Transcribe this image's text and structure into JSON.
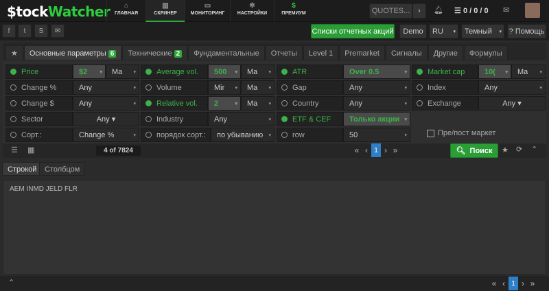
{
  "header": {
    "logo_prefix": "$tock",
    "logo_suffix": "Watcher",
    "nav": [
      {
        "icon": "home-icon",
        "glyph": "⌂",
        "label": "ГЛАВНАЯ"
      },
      {
        "icon": "bar-chart-icon",
        "glyph": "▥",
        "label": "СКРИНЕР"
      },
      {
        "icon": "monitor-icon",
        "glyph": "▭",
        "label": "МОНИТОРИНГ"
      },
      {
        "icon": "gear-icon",
        "glyph": "✲",
        "label": "НАСТРОЙКИ"
      },
      {
        "icon": "dollar-icon",
        "glyph": "$",
        "label": "ПРЕМИУМ"
      }
    ],
    "quotes_placeholder": "QUOTES...",
    "counters": "0 / 0 / 0"
  },
  "toolbar": {
    "reports_button": "Списки отчетных акций",
    "demo": "Demo",
    "lang": "RU",
    "theme": "Темный",
    "help": "? Помощь"
  },
  "tabs": [
    {
      "label": "Основные параметры",
      "badge": "6"
    },
    {
      "label": "Технические",
      "badge": "2"
    },
    {
      "label": "Фундаментальные"
    },
    {
      "label": "Отчеты"
    },
    {
      "label": "Level 1"
    },
    {
      "label": "Premarket"
    },
    {
      "label": "Сигналы"
    },
    {
      "label": "Другие"
    },
    {
      "label": "Формулы"
    }
  ],
  "filters": {
    "price": {
      "label": "Price",
      "v1": "$2",
      "v2": "Ma"
    },
    "avgvol": {
      "label": "Average vol.",
      "v1": "500",
      "v2": "Ma"
    },
    "atr": {
      "label": "ATR",
      "v1": "Over 0.5"
    },
    "mcap": {
      "label": "Market cap",
      "v1": "10(",
      "v2": "Ma"
    },
    "chg": {
      "label": "Change %",
      "v1": "Any"
    },
    "volume": {
      "label": "Volume",
      "v1": "Mir",
      "v2": "Ma"
    },
    "gap": {
      "label": "Gap",
      "v1": "Any"
    },
    "index": {
      "label": "Index",
      "v1": "Any"
    },
    "chgd": {
      "label": "Change $",
      "v1": "Any"
    },
    "relvol": {
      "label": "Relative vol.",
      "v1": "2",
      "v2": "Ma"
    },
    "country": {
      "label": "Country",
      "v1": "Any"
    },
    "exchange": {
      "label": "Exchange",
      "v1": "Any ▾"
    },
    "sector": {
      "label": "Sector",
      "v1": "Any ▾"
    },
    "industry": {
      "label": "Industry",
      "v1": "Any"
    },
    "etf": {
      "label": "ETF & CEF",
      "v1": "Только акции"
    },
    "sort": {
      "label": "Сорт.:",
      "v1": "Change %"
    },
    "order": {
      "label": "порядок сорт.:",
      "v1": "по убыванию"
    },
    "row": {
      "label": "row",
      "v1": "50"
    },
    "prepost": "Пре/пост маркет"
  },
  "results": {
    "count": "4 of 7824",
    "page": "1",
    "search": "Поиск"
  },
  "view_tabs": [
    "Строкой",
    "Столбцом"
  ],
  "output": "AEM INMD JELD FLR",
  "footer": {
    "page": "1"
  }
}
